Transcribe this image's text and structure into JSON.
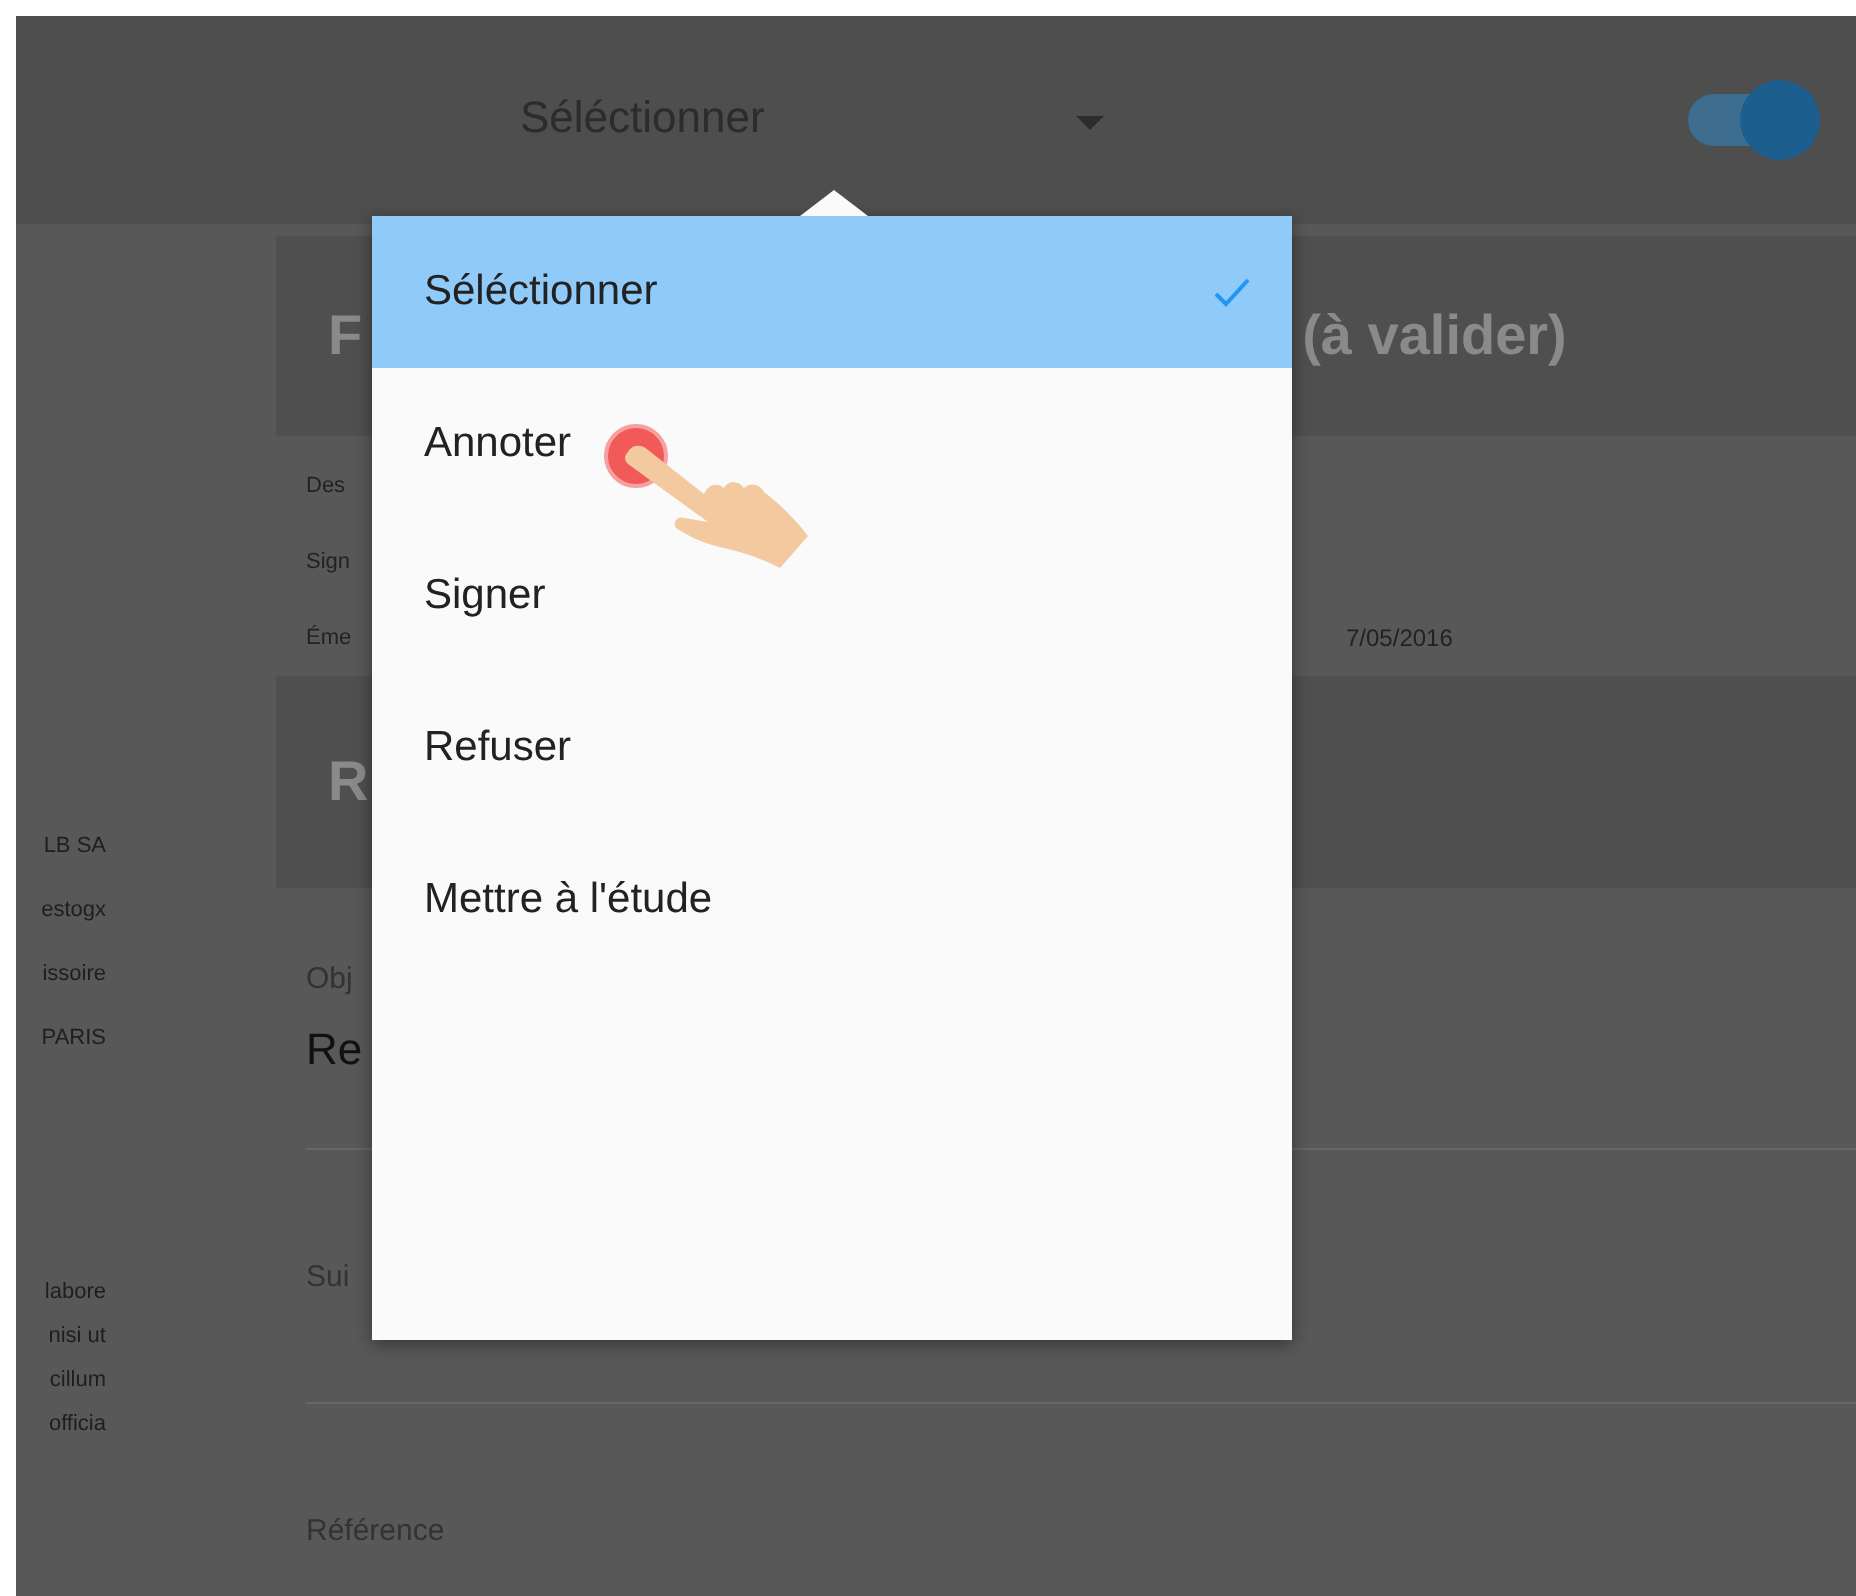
{
  "top_bar": {
    "mode_label": "Séléctionner",
    "toggle_on": true
  },
  "sidebar": {
    "upper_lines": [
      "LB SA",
      "estogx",
      "issoire",
      "PARIS"
    ],
    "lower_lines": [
      "labore",
      "nisi ut",
      "cillum",
      "officia"
    ]
  },
  "cards": [
    {
      "title_start": "F",
      "title_end": "(à valider)"
    },
    {
      "title_start": "R"
    }
  ],
  "details": [
    {
      "label": "Des"
    },
    {
      "label": "Sign"
    },
    {
      "label": "Éme",
      "value": "7/05/2016"
    }
  ],
  "fields": [
    {
      "label": "Obj",
      "value": "Re"
    },
    {
      "label": "Sui"
    },
    {
      "label": "Référence"
    }
  ],
  "menu": {
    "items": [
      {
        "label": "Séléctionner",
        "selected": true
      },
      {
        "label": "Annoter",
        "selected": false
      },
      {
        "label": "Signer",
        "selected": false
      },
      {
        "label": "Refuser",
        "selected": false
      },
      {
        "label": "Mettre à l'étude",
        "selected": false
      }
    ]
  }
}
